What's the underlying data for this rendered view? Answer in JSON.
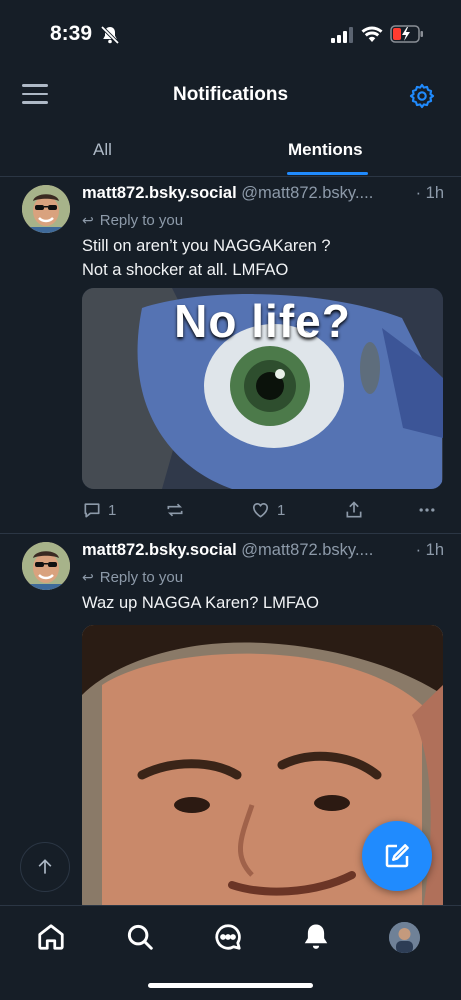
{
  "status_bar": {
    "time": "8:39",
    "icons": [
      "bell-slash-icon",
      "signal-icon",
      "wifi-icon",
      "battery-charging-icon"
    ]
  },
  "header": {
    "title": "Notifications",
    "menu_icon": "hamburger-menu-icon",
    "settings_icon": "gear-icon"
  },
  "tabs": [
    {
      "label": "All",
      "active": false
    },
    {
      "label": "Mentions",
      "active": true
    }
  ],
  "posts": [
    {
      "display_name": "matt872.bsky.social",
      "handle": "@matt872.bsky....",
      "time": "· 1h",
      "reply_label": "Reply to you",
      "text": "Still on aren’t you NAGGAKaren ?\nNot a shocker at all.  LMFAO",
      "media_caption": "No life?",
      "reply_count": "1",
      "repost_count": "",
      "like_count": "1"
    },
    {
      "display_name": "matt872.bsky.social",
      "handle": "@matt872.bsky....",
      "time": "· 1h",
      "reply_label": "Reply to you",
      "text": "Waz up NAGGA Karen? LMFAO"
    }
  ],
  "colors": {
    "background": "#161e27",
    "accent": "#208bfe",
    "muted": "#8d9aa9"
  },
  "bottom_nav": [
    "home-icon",
    "search-icon",
    "chat-icon",
    "bell-icon",
    "profile-avatar"
  ]
}
